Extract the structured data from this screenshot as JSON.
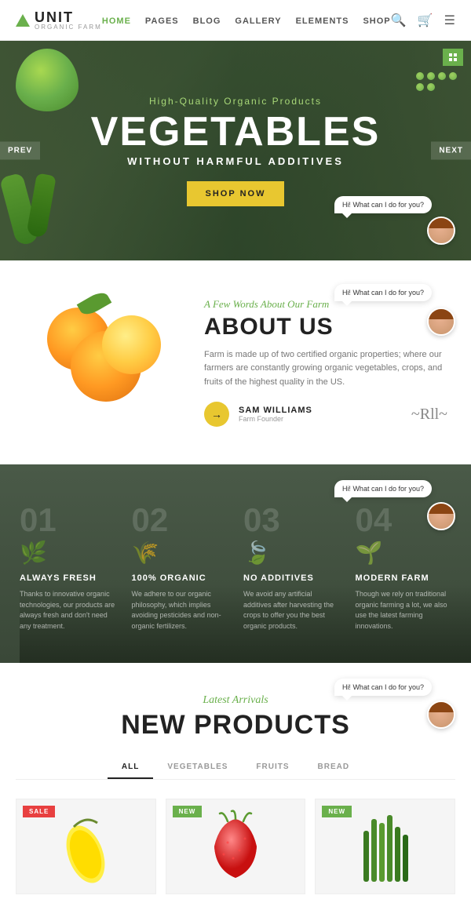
{
  "logo": {
    "name": "UNIT",
    "sub": "ORGANIC FARM"
  },
  "nav": {
    "links": [
      "HOME",
      "PAGES",
      "BLOG",
      "GALLERY",
      "ELEMENTS",
      "SHOP"
    ],
    "active": "HOME"
  },
  "hero": {
    "subtitle": "High-Quality Organic Products",
    "title": "VEGETABLES",
    "desc": "WITHOUT HARMFUL ADDITIVES",
    "cta": "SHOP NOW",
    "prev": "prev",
    "next": "next"
  },
  "chat": {
    "message": "Hi! What can I do for you?"
  },
  "about": {
    "tag": "A Few Words About Our Farm",
    "title": "ABOUT US",
    "text": "Farm is made up of two certified organic properties; where our farmers are constantly growing organic vegetables, crops, and fruits of the highest quality in the US.",
    "author_name": "SAM WILLIAMS",
    "author_role": "Farm Founder",
    "signature": "~Rll~"
  },
  "features": {
    "items": [
      {
        "num": "01",
        "icon": "🌿",
        "title": "ALWAYS FRESH",
        "text": "Thanks to innovative organic technologies, our products are always fresh and don't need any treatment."
      },
      {
        "num": "02",
        "icon": "🌾",
        "title": "100% ORGANIC",
        "text": "We adhere to our organic philosophy, which implies avoiding pesticides and non-organic fertilizers."
      },
      {
        "num": "03",
        "icon": "🍃",
        "title": "NO ADDITIVES",
        "text": "We avoid any artificial additives after harvesting the crops to offer you the best organic products."
      },
      {
        "num": "04",
        "icon": "🌱",
        "title": "MODERN FARM",
        "text": "Though we rely on traditional organic farming a lot, we also use the latest farming innovations."
      }
    ]
  },
  "products": {
    "tag": "Latest Arrivals",
    "title": "NEW PRODUCTS",
    "tabs": [
      "ALL",
      "VEGETABLES",
      "FRUITS",
      "BREAD"
    ],
    "active_tab": "ALL",
    "items": [
      {
        "badge": "SALE",
        "badge_type": "sale",
        "type": "banana"
      },
      {
        "badge": "NEW",
        "badge_type": "new",
        "type": "strawberry"
      },
      {
        "badge": "NEW",
        "badge_type": "new",
        "type": "greens"
      }
    ]
  }
}
